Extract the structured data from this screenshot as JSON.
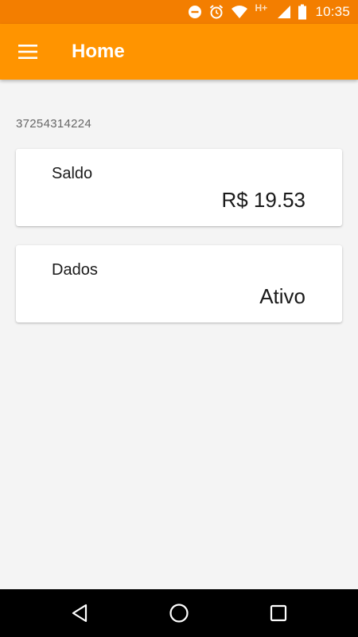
{
  "status_bar": {
    "time": "10:35",
    "network_type": "H+",
    "icons": [
      "do-not-disturb-icon",
      "alarm-icon",
      "wifi-icon",
      "cellular-signal-icon",
      "battery-icon"
    ]
  },
  "app_bar": {
    "title": "Home",
    "menu_icon": "hamburger-menu-icon",
    "color": "#ff9400"
  },
  "account": {
    "number": "37254314224"
  },
  "cards": {
    "balance": {
      "label": "Saldo",
      "value": "R$ 19.53"
    },
    "data": {
      "label": "Dados",
      "value": "Ativo"
    }
  },
  "nav_bar": {
    "icons": [
      "back-icon",
      "home-icon",
      "recents-icon"
    ]
  },
  "colors": {
    "status_bar": "#f37e00",
    "app_bar": "#ff9400",
    "background": "#f4f4f4"
  }
}
